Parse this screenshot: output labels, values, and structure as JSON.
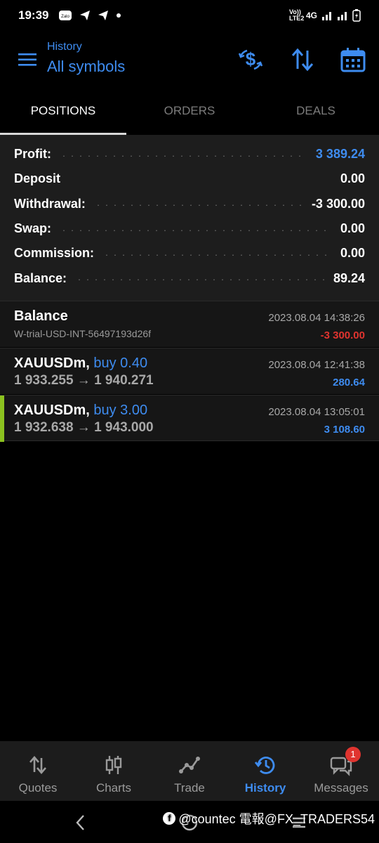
{
  "status_bar": {
    "time": "19:39",
    "network": "4G",
    "volte": "Vo)) LTE2"
  },
  "header": {
    "subtitle": "History",
    "title": "All symbols"
  },
  "tabs": [
    {
      "label": "POSITIONS",
      "active": true
    },
    {
      "label": "ORDERS",
      "active": false
    },
    {
      "label": "DEALS",
      "active": false
    }
  ],
  "summary": {
    "profit_label": "Profit:",
    "profit_value": "3 389.24",
    "deposit_label": "Deposit",
    "deposit_value": "0.00",
    "withdrawal_label": "Withdrawal:",
    "withdrawal_value": "-3 300.00",
    "swap_label": "Swap:",
    "swap_value": "0.00",
    "commission_label": "Commission:",
    "commission_value": "0.00",
    "balance_label": "Balance:",
    "balance_value": "89.24"
  },
  "deals": [
    {
      "name": "Balance",
      "comment": "W-trial-USD-INT-56497193d26f",
      "time": "2023.08.04 14:38:26",
      "amount": "-3 300.00"
    },
    {
      "symbol": "XAUUSDm,",
      "side": "buy 0.40",
      "prices": "1 933.255 → 1 940.271",
      "time": "2023.08.04 12:41:38",
      "amount": "280.64"
    },
    {
      "symbol": "XAUUSDm,",
      "side": "buy 3.00",
      "prices": "1 932.638 → 1 943.000",
      "time": "2023.08.04 13:05:01",
      "amount": "3 108.60"
    }
  ],
  "bottom_nav": [
    {
      "label": "Quotes",
      "icon": "quotes-arrows-icon"
    },
    {
      "label": "Charts",
      "icon": "candlestick-icon"
    },
    {
      "label": "Trade",
      "icon": "trade-line-icon"
    },
    {
      "label": "History",
      "icon": "history-clock-icon",
      "active": true
    },
    {
      "label": "Messages",
      "icon": "chat-bubbles-icon",
      "badge": "1"
    }
  ],
  "watermark": "@countec 電報@FX_TRADERS54",
  "colors": {
    "accent": "#3e8cf0",
    "negative": "#e0342f",
    "buy_marker": "#8bc11f"
  }
}
